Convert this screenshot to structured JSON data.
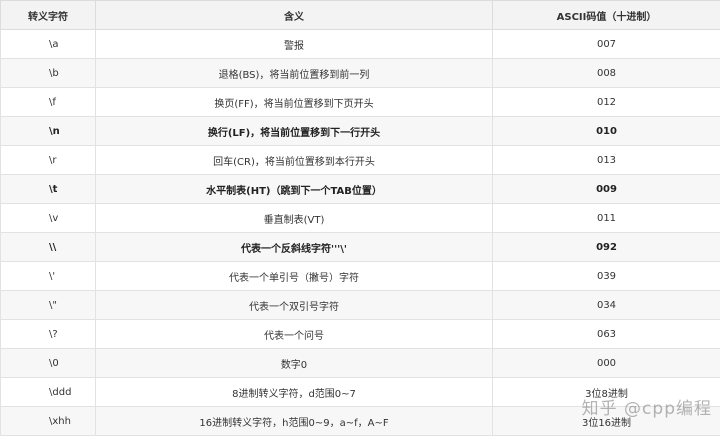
{
  "headers": [
    "转义字符",
    "含义",
    "ASCII码值（十进制）"
  ],
  "rows": [
    {
      "c": "\\a",
      "m": "警报",
      "v": "007",
      "bold": false
    },
    {
      "c": "\\b",
      "m": "退格(BS)，将当前位置移到前一列",
      "v": "008",
      "bold": false
    },
    {
      "c": "\\f",
      "m": "换页(FF)，将当前位置移到下页开头",
      "v": "012",
      "bold": false
    },
    {
      "c": "\\n",
      "m": "换行(LF)，将当前位置移到下一行开头",
      "v": "010",
      "bold": true
    },
    {
      "c": "\\r",
      "m": "回车(CR)，将当前位置移到本行开头",
      "v": "013",
      "bold": false
    },
    {
      "c": "\\t",
      "m": "水平制表(HT)（跳到下一个TAB位置）",
      "v": "009",
      "bold": true
    },
    {
      "c": "\\v",
      "m": "垂直制表(VT)",
      "v": "011",
      "bold": false
    },
    {
      "c": "\\\\",
      "m": "代表一个反斜线字符'''\\'",
      "v": "092",
      "bold": true
    },
    {
      "c": "\\'",
      "m": "代表一个单引号（撇号）字符",
      "v": "039",
      "bold": false
    },
    {
      "c": "\\\"",
      "m": "代表一个双引号字符",
      "v": "034",
      "bold": false
    },
    {
      "c": "\\?",
      "m": "代表一个问号",
      "v": "063",
      "bold": false
    },
    {
      "c": "\\0",
      "m": "数字0",
      "v": "000",
      "bold": false
    },
    {
      "c": "\\ddd",
      "m": "8进制转义字符，d范围0~7",
      "v": "3位8进制",
      "bold": false
    },
    {
      "c": "\\xhh",
      "m": "16进制转义字符，h范围0~9，a~f，A~F",
      "v": "3位16进制",
      "bold": false
    }
  ],
  "watermark": "知乎 @cpp编程"
}
